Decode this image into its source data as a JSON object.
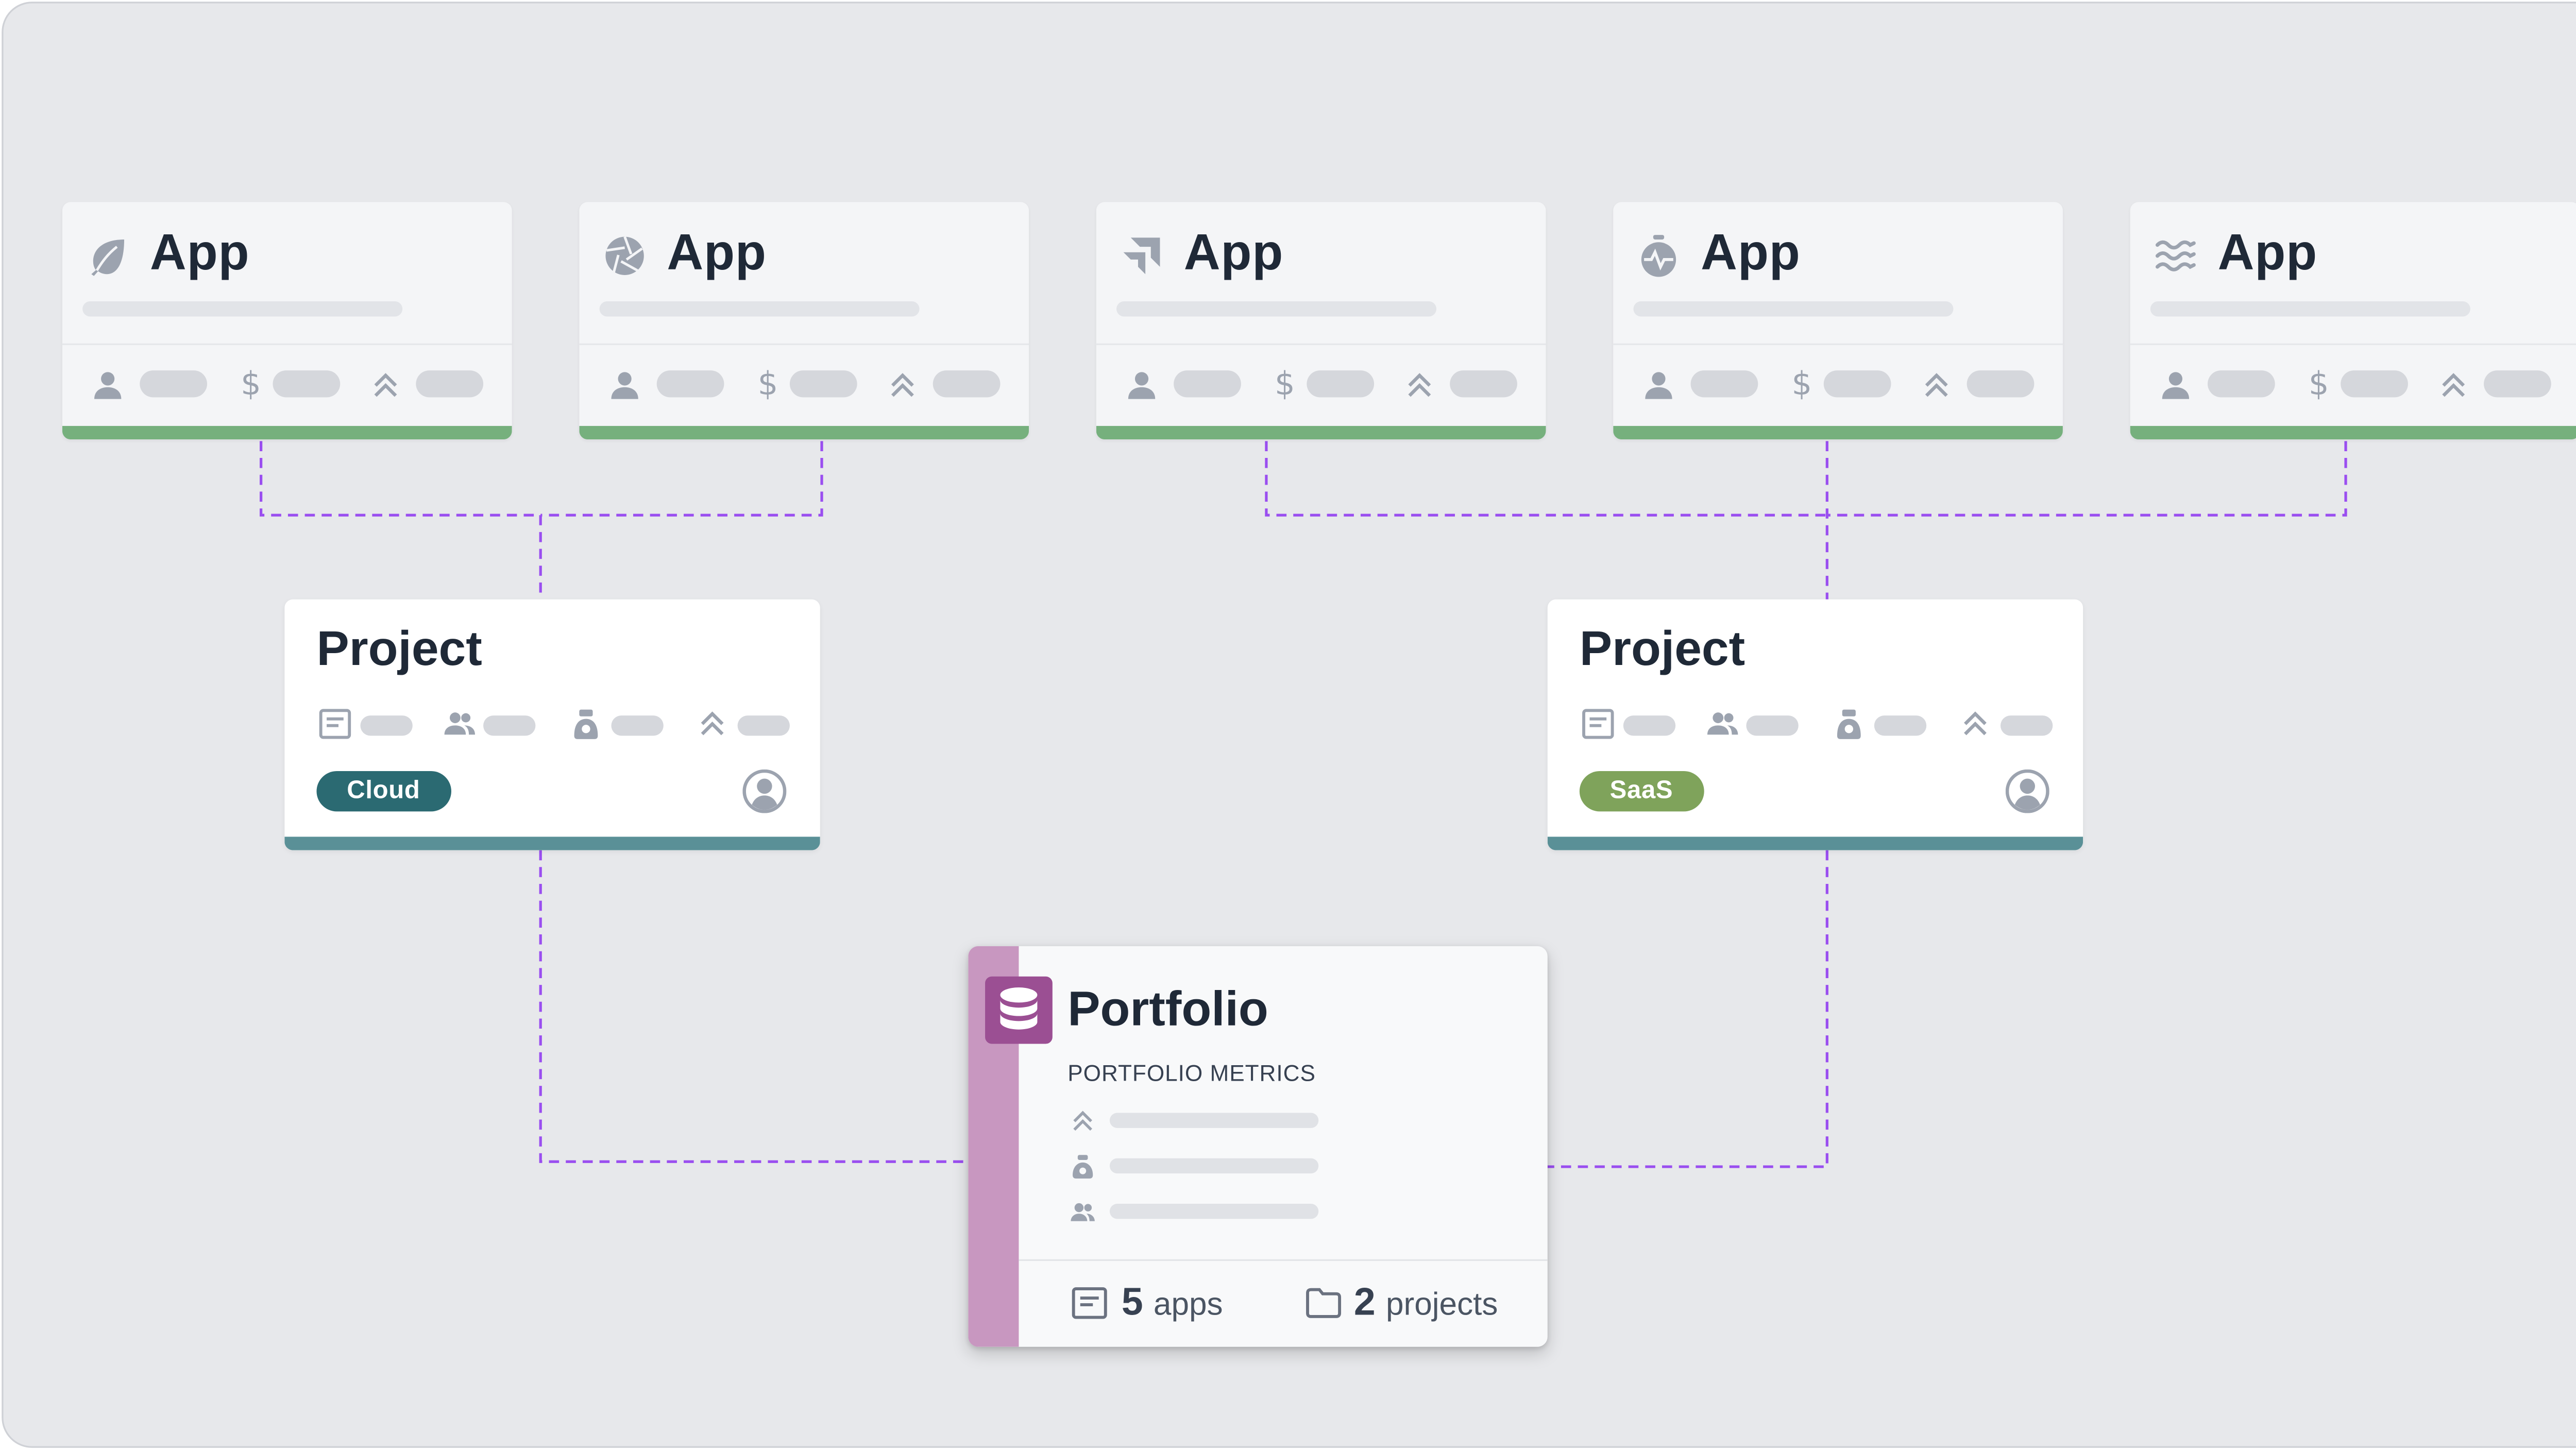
{
  "apps": [
    {
      "title": "App",
      "icon": "leaf-icon"
    },
    {
      "title": "App",
      "icon": "aperture-icon"
    },
    {
      "title": "App",
      "icon": "arrow-icon"
    },
    {
      "title": "App",
      "icon": "stopwatch-icon"
    },
    {
      "title": "App",
      "icon": "waves-icon"
    }
  ],
  "projects": [
    {
      "title": "Project",
      "tag": "Cloud",
      "tag_color": "#2b6a72"
    },
    {
      "title": "Project",
      "tag": "SaaS",
      "tag_color": "#7fa35b"
    }
  ],
  "portfolio": {
    "title": "Portfolio",
    "subtitle": "PORTFOLIO METRICS",
    "apps_count": "5",
    "apps_label": "apps",
    "projects_count": "2",
    "projects_label": "projects"
  },
  "colors": {
    "connector": "#9a4ef0",
    "app_accent": "#76b07d",
    "project_accent": "#5a9097",
    "portfolio_accent": "#c897c0"
  }
}
